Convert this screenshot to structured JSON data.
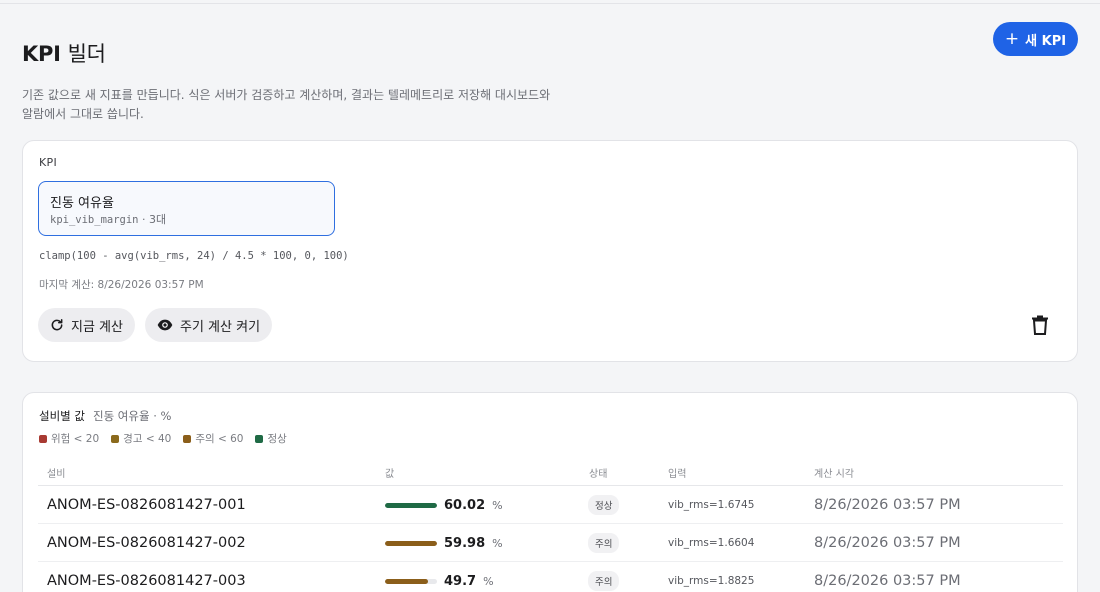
{
  "header": {
    "title_bold": "KPI",
    "title_rest": "빌더",
    "new_button_label": "새 KPI",
    "description_line1": "기존 값으로 새 지표를 만듭니다. 식은 서버가 검증하고 계산하며, 결과는 텔레메트리로 저장해 대시보드와",
    "description_line2": "알람에서 그대로 씁니다."
  },
  "kpi_section": {
    "label": "KPI",
    "selected": {
      "name": "진동 여유율",
      "code": "kpi_vib_margin",
      "count": "· 3대"
    },
    "formula": "clamp(100 - avg(vib_rms, 24) / 4.5 * 100, 0, 100)",
    "last_calc": "마지막 계산: 8/26/2026 03:57 PM",
    "calc_now_label": "지금 계산",
    "periodic_label": "주기 계산 켜기"
  },
  "values_section": {
    "title": "설비별 값",
    "kpi_ref": "진동 여유율 · %",
    "legend": [
      {
        "label": "위험 < 20",
        "color": "#a83a32"
      },
      {
        "label": "경고 < 40",
        "color": "#8b6a1c"
      },
      {
        "label": "주의 < 60",
        "color": "#8b5e1a"
      },
      {
        "label": "정상",
        "color": "#1f6a45"
      }
    ],
    "columns": {
      "device": "설비",
      "value": "값",
      "status": "상태",
      "input": "입력",
      "time": "계산 시각"
    },
    "rows": [
      {
        "device": "ANOM-ES-0826081427-001",
        "value": "60.02",
        "fraction": 1.0,
        "unit": "%",
        "status": "정상",
        "input": "vib_rms=1.6745",
        "time": "8/26/2026 03:57 PM",
        "color": "#1f6a45"
      },
      {
        "device": "ANOM-ES-0826081427-002",
        "value": "59.98",
        "fraction": 0.999,
        "unit": "%",
        "status": "주의",
        "input": "vib_rms=1.6604",
        "time": "8/26/2026 03:57 PM",
        "color": "#8b5e1a"
      },
      {
        "device": "ANOM-ES-0826081427-003",
        "value": "49.7",
        "fraction": 0.83,
        "unit": "%",
        "status": "주의",
        "input": "vib_rms=1.8825",
        "time": "8/26/2026 03:57 PM",
        "color": "#8b5e1a"
      }
    ]
  }
}
